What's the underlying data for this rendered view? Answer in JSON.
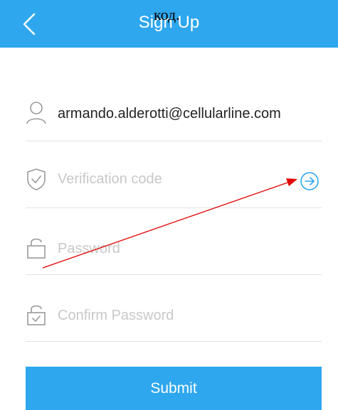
{
  "header": {
    "title": "Sign Up",
    "back_icon": "chevron-left-icon",
    "overlay_text": "код.",
    "background": "#2ea7ee"
  },
  "form": {
    "email": {
      "icon": "user-icon",
      "value": "armando.alderotti@cellularline.com"
    },
    "verification": {
      "icon": "shield-check-icon",
      "placeholder": "Verification code",
      "send_icon": "arrow-right-circle-icon"
    },
    "password": {
      "icon": "lock-icon",
      "placeholder": "Password"
    },
    "confirm_password": {
      "icon": "lock-check-icon",
      "placeholder": "Confirm Password"
    }
  },
  "submit": {
    "label": "Submit"
  },
  "colors": {
    "accent": "#2ea7ee",
    "annotation_arrow": "#e00000",
    "placeholder": "#c8c8c8"
  }
}
